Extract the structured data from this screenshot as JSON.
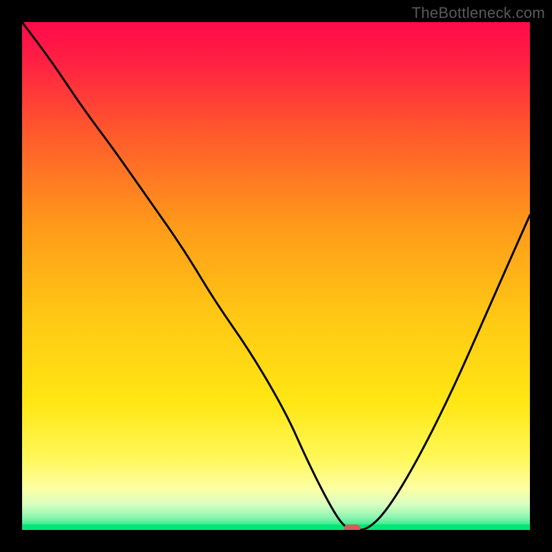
{
  "watermark": "TheBottleneck.com",
  "chart_data": {
    "type": "line",
    "title": "",
    "xlabel": "",
    "ylabel": "",
    "xlim": [
      0,
      100
    ],
    "ylim": [
      0,
      100
    ],
    "grid": false,
    "series": [
      {
        "name": "bottleneck-curve",
        "x": [
          0,
          6,
          12,
          18,
          25,
          32,
          38,
          45,
          52,
          56,
          60,
          63,
          65,
          68,
          72,
          78,
          85,
          92,
          100
        ],
        "y": [
          100,
          92,
          83,
          75,
          65,
          55,
          45,
          35,
          23,
          14,
          6,
          1,
          0,
          0,
          4,
          14,
          28,
          44,
          62
        ]
      }
    ],
    "marker": {
      "x": 65,
      "y": 0,
      "color": "#d85a5a"
    },
    "gradient_stops": [
      {
        "offset": 0.0,
        "color": "#ff0a4a"
      },
      {
        "offset": 0.08,
        "color": "#ff2142"
      },
      {
        "offset": 0.22,
        "color": "#ff5a2c"
      },
      {
        "offset": 0.4,
        "color": "#ff9a1a"
      },
      {
        "offset": 0.58,
        "color": "#ffc814"
      },
      {
        "offset": 0.75,
        "color": "#ffe714"
      },
      {
        "offset": 0.86,
        "color": "#fff85a"
      },
      {
        "offset": 0.92,
        "color": "#fcffa6"
      },
      {
        "offset": 0.95,
        "color": "#d8ffc0"
      },
      {
        "offset": 0.975,
        "color": "#8cf5b0"
      },
      {
        "offset": 1.0,
        "color": "#00e777"
      }
    ]
  }
}
